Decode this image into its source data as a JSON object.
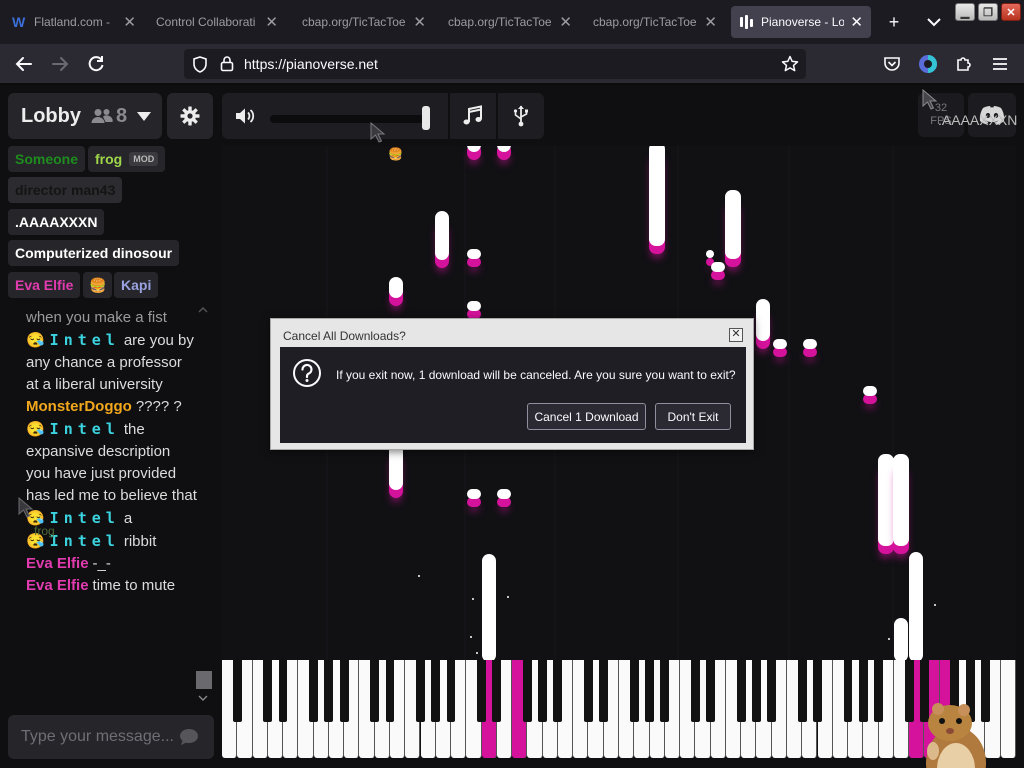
{
  "browser": {
    "tabs": [
      {
        "title": "Flatland.com -",
        "close": "✕",
        "active": false
      },
      {
        "title": "Control Collaborati",
        "close": "✕",
        "active": false
      },
      {
        "title": "cbap.org/TicTacToe",
        "close": "✕",
        "active": false
      },
      {
        "title": "cbap.org/TicTacToe",
        "close": "✕",
        "active": false
      },
      {
        "title": "cbap.org/TicTacToe",
        "close": "✕",
        "active": false
      },
      {
        "title": "Pianoverse - Lob",
        "close": "✕",
        "active": true
      }
    ],
    "new_tab": "+",
    "tab_list": "⌄",
    "window_buttons": {
      "minimize": "▁",
      "restore": "❐",
      "close": "✕"
    },
    "url": "https://pianoverse.net"
  },
  "lobby": {
    "name": "Lobby",
    "user_count": "8"
  },
  "fps": {
    "value": "32",
    "label": "FPS"
  },
  "top_cursor_name": ".AAAAXXXN",
  "users": [
    {
      "name": "Someone",
      "color": "#1e8c1e"
    },
    {
      "name": "frog",
      "color": "#9fd64a",
      "badge": "MOD"
    },
    {
      "name": "director man43",
      "color": "#1a1a1a"
    },
    {
      "name": ".AAAAXXXN",
      "color": "#ffffff"
    },
    {
      "name": "Computerized dinosour",
      "color": "#ffffff"
    },
    {
      "name": "Eva Elfie",
      "color": "#e23bb0"
    },
    {
      "name": "🍔",
      "color": "#ffffff"
    },
    {
      "name": "Kapi",
      "color": "#9aa2e0"
    }
  ],
  "chat": {
    "messages": [
      {
        "name": "",
        "text": "when you make a fist",
        "style": "text"
      },
      {
        "name": "😪Intel",
        "text": "are you by any chance a professor at a liberal university",
        "style": "intel"
      },
      {
        "name": "MonsterDoggo",
        "text": "????  ?",
        "style": "doggo"
      },
      {
        "name": "😪Intel",
        "text": "the expansive description you have just provided has led me to believe that",
        "style": "intel"
      },
      {
        "name": "😪Intel",
        "text": "a",
        "style": "intel"
      },
      {
        "name": "😪Intel",
        "text": "ribbit",
        "style": "intel"
      },
      {
        "name": "Eva Elfie",
        "text": "-_-",
        "style": "eva"
      },
      {
        "name": "Eva Elfie",
        "text": "time to mute",
        "style": "eva"
      }
    ],
    "input_placeholder": "Type your message...",
    "cursor_label": "frog"
  },
  "dialog": {
    "title": "Cancel All Downloads?",
    "message": "If you exit now, 1 download will be canceled. Are you sure you want to exit?",
    "cancel_label": "Cancel 1 Download",
    "dont_exit_label": "Don't Exit",
    "close": "✕"
  },
  "colors": {
    "note_highlight": "#d4129c",
    "app_background": "#0f0f11",
    "panel": "#26262a",
    "intel_name": "#3ad3df",
    "doggo_name": "#f2a81d",
    "eva_name": "#e23bb0"
  },
  "icons": {
    "lobby_users": "users-icon",
    "dropdown": "caret-down-icon",
    "settings": "gear-icon",
    "volume": "speaker-icon",
    "music": "music-note-icon",
    "usb": "usb-icon",
    "discord": "discord-icon",
    "send": "chat-bubble-icon",
    "question": "question-icon"
  },
  "piano": {
    "active_white_keys": [
      17,
      19,
      45,
      46,
      47
    ]
  }
}
